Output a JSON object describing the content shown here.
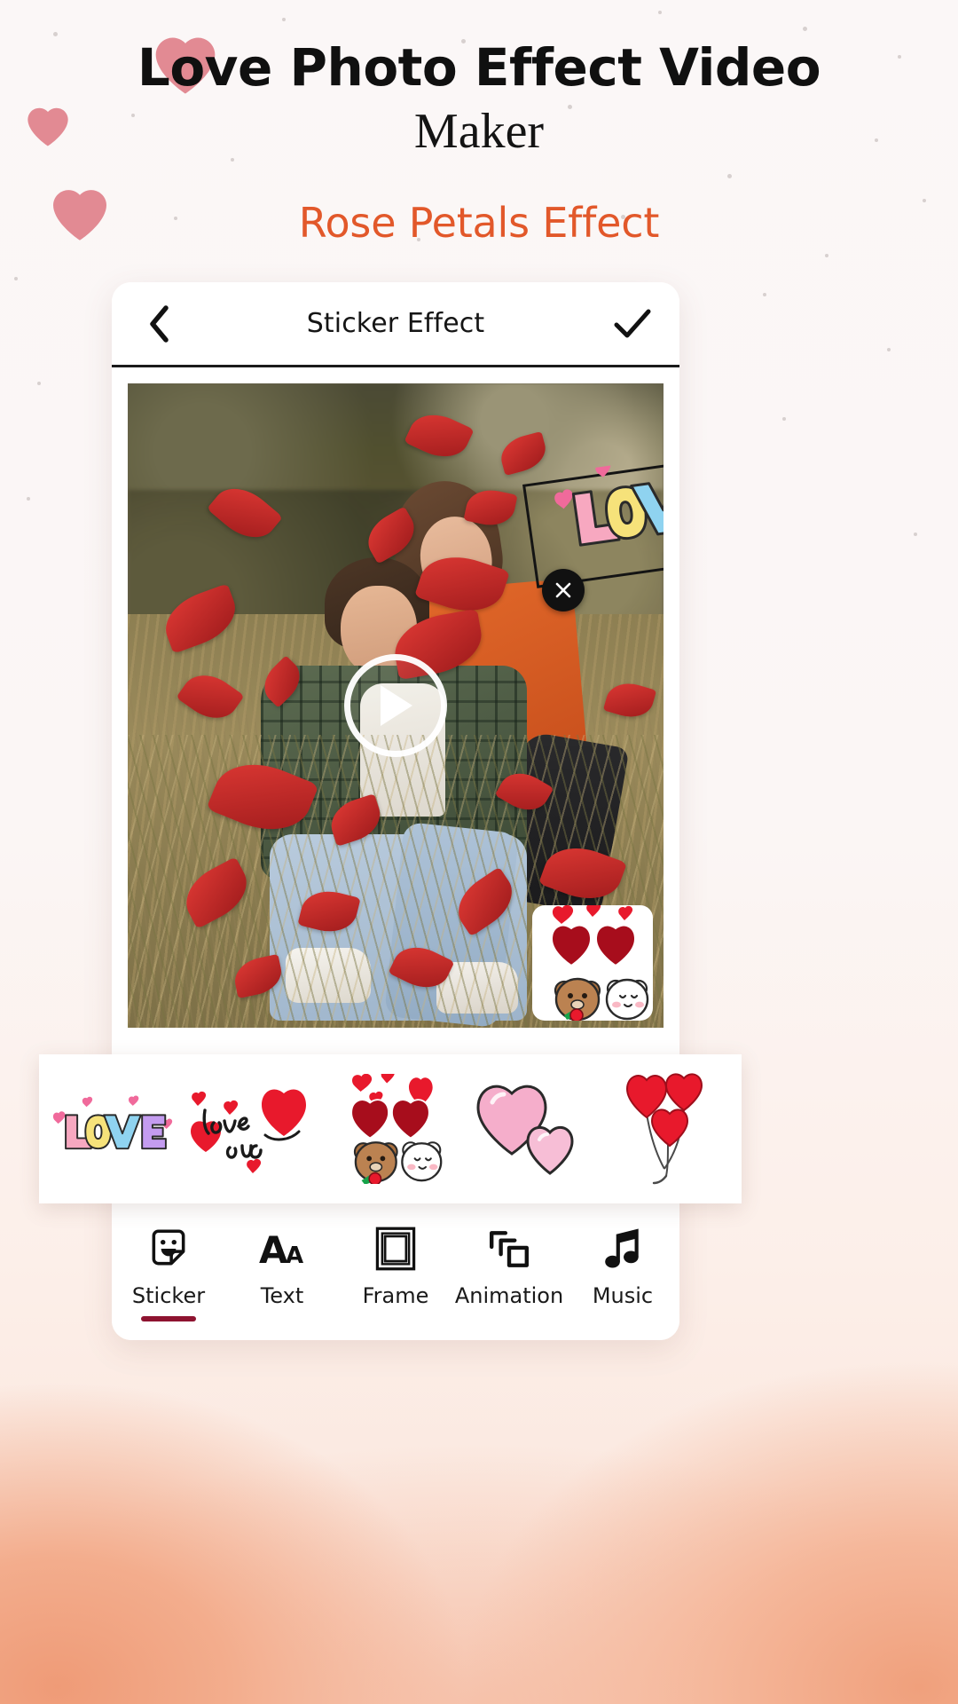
{
  "promo": {
    "title_line1": "Love Photo Effect Video",
    "title_line2": "Maker",
    "subtitle": "Rose Petals Effect",
    "subtitle_color": "#e2582a",
    "accent_color": "#8e1330"
  },
  "appbar": {
    "back_icon": "chevron-left-icon",
    "title": "Sticker Effect",
    "confirm_icon": "check-icon"
  },
  "canvas": {
    "media_type": "video-preview",
    "media_description": "Couple sitting in a dry grass field with red rose petals falling",
    "play_icon": "play-icon",
    "selected_sticker": {
      "name": "LOVE",
      "rotation_degrees": -8,
      "delete_icon": "close-icon",
      "resize_icon": "resize-diagonal-icon"
    },
    "placed_stickers": [
      {
        "name": "LOVE"
      },
      {
        "name": "Bear and Bunny Couple"
      }
    ]
  },
  "sticker_picker": {
    "items": [
      {
        "id": "love-letters",
        "label": "LOVE"
      },
      {
        "id": "love-you-script",
        "label": "love you"
      },
      {
        "id": "bear-bunny-couple",
        "label": "Bear and Bunny Couple"
      },
      {
        "id": "pink-double-heart",
        "label": "Pink Double Heart"
      },
      {
        "id": "heart-balloons",
        "label": "Heart Balloons"
      }
    ]
  },
  "tabs": {
    "active": "Sticker",
    "items": [
      {
        "label": "Sticker",
        "icon": "sticker-icon",
        "active": true
      },
      {
        "label": "Text",
        "icon": "text-icon",
        "active": false
      },
      {
        "label": "Frame",
        "icon": "frame-icon",
        "active": false
      },
      {
        "label": "Animation",
        "icon": "animation-icon",
        "active": false
      },
      {
        "label": "Music",
        "icon": "music-note-icon",
        "active": false
      }
    ]
  }
}
